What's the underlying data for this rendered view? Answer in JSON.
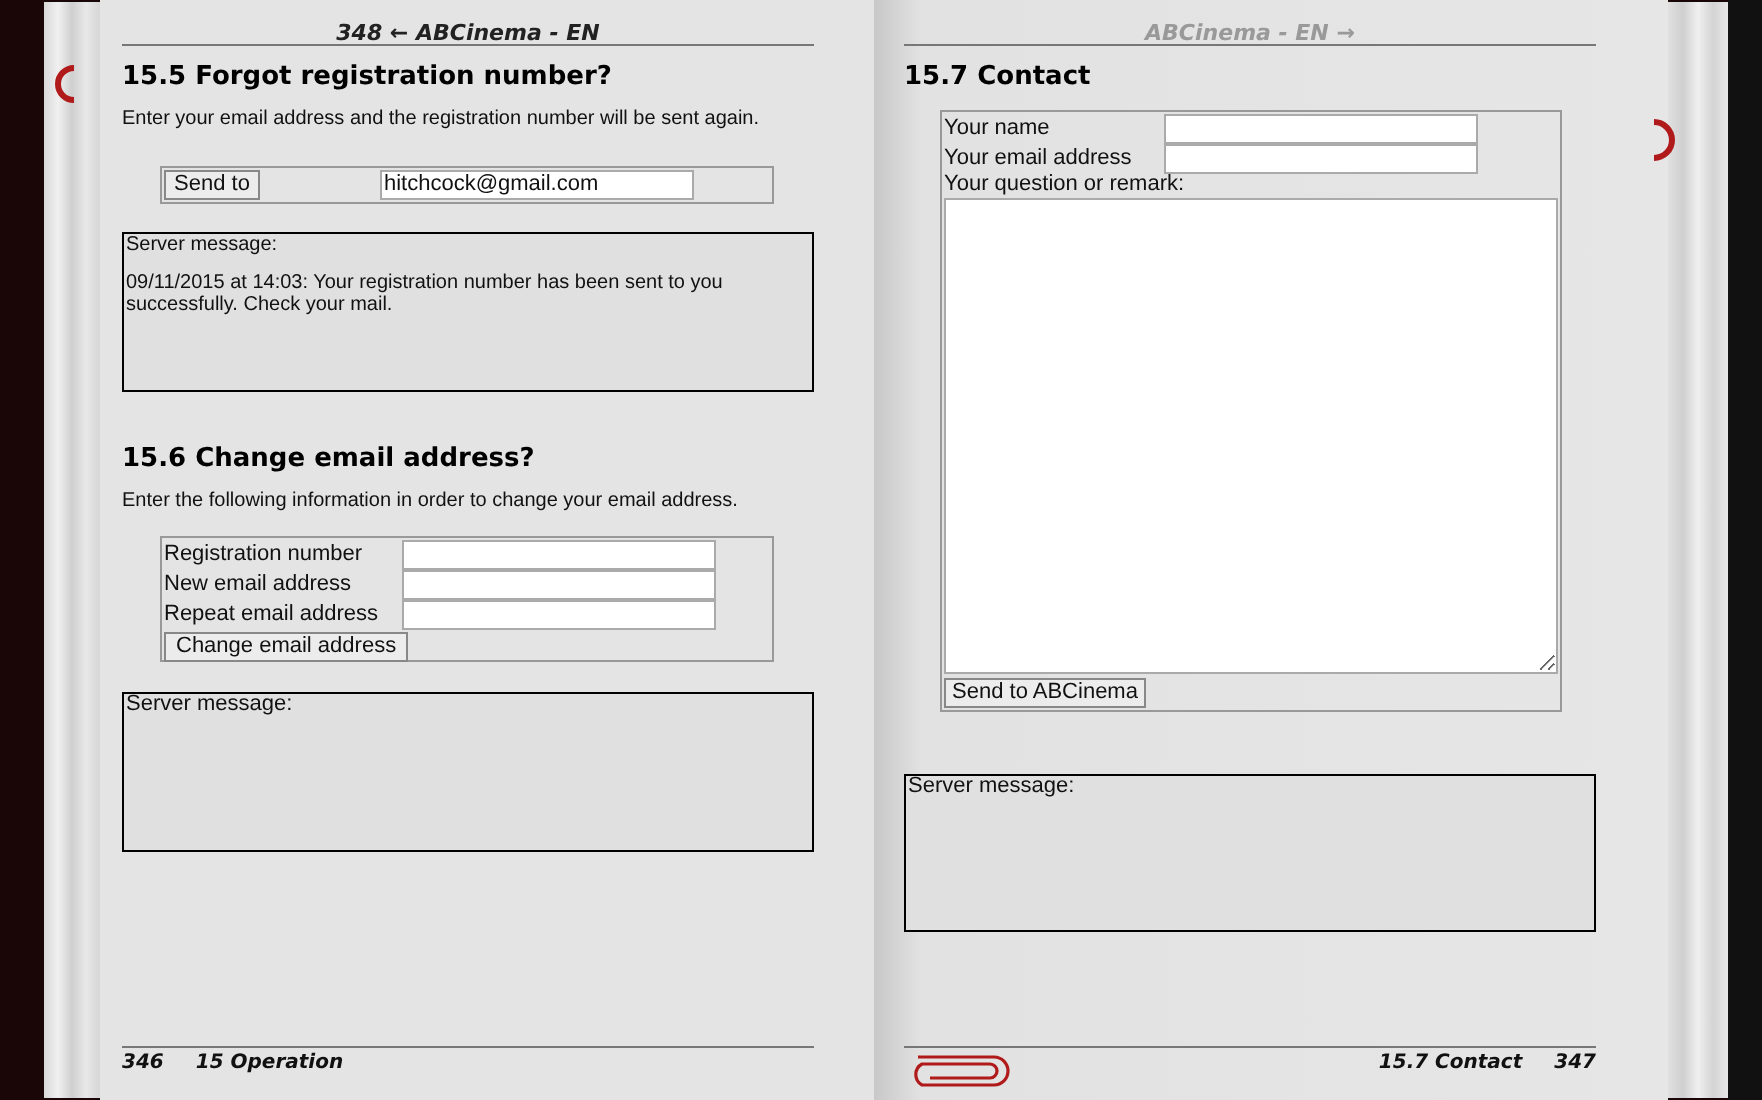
{
  "left_page": {
    "header": "348 ← ABCinema - EN",
    "forgot": {
      "heading": "15.5 Forgot registration number?",
      "intro": "Enter your email address and the registration number will be sent again.",
      "button": "Send to",
      "email_value": "hitchcock@gmail.com"
    },
    "server_message_1": {
      "label": "Server message:",
      "text": "09/11/2015 at 14:03: Your registration number has been sent to you successfully. Check your mail."
    },
    "change": {
      "heading": "15.6 Change email address?",
      "intro": "Enter the following information in order to change your email address.",
      "fields": [
        {
          "label": "Registration number"
        },
        {
          "label": "New email address"
        },
        {
          "label": "Repeat email address"
        }
      ],
      "button": "Change email address"
    },
    "server_message_2": {
      "label": "Server message:"
    },
    "footer": {
      "page_number": "346",
      "chapter": "15 Operation"
    }
  },
  "right_page": {
    "header": "ABCinema - EN →",
    "contact": {
      "heading": "15.7 Contact",
      "fields": [
        {
          "label": "Your name"
        },
        {
          "label": "Your email address"
        }
      ],
      "remark_label": "Your question or remark:",
      "button": "Send to ABCinema"
    },
    "server_message": {
      "label": "Server message:"
    },
    "footer": {
      "section": "15.7 Contact",
      "page_number": "347"
    }
  }
}
